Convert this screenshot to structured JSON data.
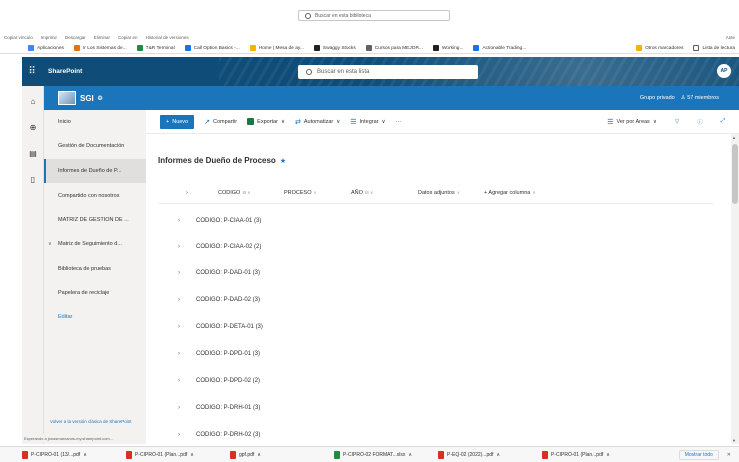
{
  "browser": {
    "search_placeholder": "Buscar en esta biblioteca",
    "commands": [
      "Copiar vínculo",
      "Imprimir",
      "Descargar",
      "Eliminar",
      "Copiar en",
      "Historial de versiones"
    ],
    "commands_right": "Ante",
    "bookmarks": [
      {
        "label": "Aplicaciones",
        "color": "#4285f4"
      },
      {
        "label": "Ir Los Sistemas de...",
        "color": "#e8710a"
      },
      {
        "label": "T&R Terminal",
        "color": "#1e8e3e"
      },
      {
        "label": "Call Option Basics -...",
        "color": "#1a73e8"
      },
      {
        "label": "Home | Mesa de ay...",
        "color": "#f4b400"
      },
      {
        "label": "Swaggy Stocks",
        "color": "#202124"
      },
      {
        "label": "Cursos para MEJOR...",
        "color": "#5f6368"
      },
      {
        "label": "Working...",
        "color": "#202124"
      },
      {
        "label": "Actionable Trading...",
        "color": "#1a73e8"
      }
    ],
    "bookmarks_right": [
      "Otros marcadores",
      "Lista de lectura"
    ],
    "downloads": [
      {
        "label": "P-CIPRO-01 (13/...pdf",
        "color": "#d93025"
      },
      {
        "label": "P-CIPRO-01 (Plan...pdf",
        "color": "#d93025"
      },
      {
        "label": "gpf.pdf",
        "color": "#d93025"
      },
      {
        "label": "P-CIPRO-02 FORMAT...xlsx",
        "color": "#1e8e3e"
      },
      {
        "label": "P-EQ-02 (2022)...pdf",
        "color": "#d93025"
      },
      {
        "label": "P-CIPRO-01 (Plan...pdf",
        "color": "#d93025"
      }
    ],
    "downloads_more": "Mostrar todo",
    "status": "Esperando a jonasmarcanos-my.sharepoint.com..."
  },
  "suitebar": {
    "brand": "SharePoint",
    "search_placeholder": "Buscar en esta lista",
    "avatar_initials": "AP"
  },
  "site": {
    "name": "SGI",
    "privacy": "Grupo privado",
    "members": "57 miembros"
  },
  "leftnav": {
    "items": [
      {
        "label": "Inicio"
      },
      {
        "label": "Gestión de Documentación"
      },
      {
        "label": "Informes de Dueño de P..."
      },
      {
        "label": "Compartido con nosotros"
      },
      {
        "label": "MATRIZ DE GESTION DE ..."
      },
      {
        "label": "Matriz de Seguimiento d..."
      },
      {
        "label": "Biblioteca de pruebas"
      },
      {
        "label": "Papelera de reciclaje"
      },
      {
        "label": "Editar"
      }
    ],
    "classic_link": "Volver a la versión clásica de SharePoint"
  },
  "cmdbar": {
    "new": "Nuevo",
    "share": "Compartir",
    "export": "Exportar",
    "automate": "Automatizar",
    "integrate": "Integrar",
    "more": "···",
    "view": "Ver por Areas"
  },
  "list": {
    "title": "Informes de Dueño de Proceso",
    "columns": [
      "CODIGO",
      "PROCESO",
      "AÑO",
      "Datos adjuntos",
      "+ Agregar columna"
    ],
    "groups": [
      "CODIGO: P-CIAA-01 (3)",
      "CODIGO: P-CIAA-02 (2)",
      "CODIGO: P-DAD-01 (3)",
      "CODIGO: P-DAD-02 (3)",
      "CODIGO: P-DETA-01 (3)",
      "CODIGO: P-DPD-01 (3)",
      "CODIGO: P-DPD-02 (2)",
      "CODIGO: P-DRH-01 (3)",
      "CODIGO: P-DRH-02 (3)"
    ]
  },
  "colors": {
    "suite": "#0f4d78",
    "site_header": "#1b75bb",
    "accent": "#1b75bb",
    "nav_bg": "#f3f2f1"
  }
}
